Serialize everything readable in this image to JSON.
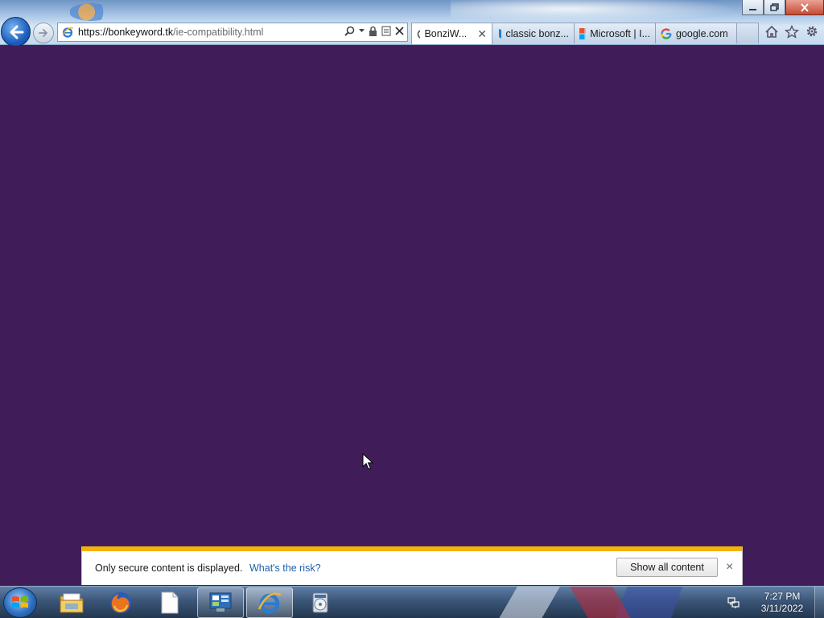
{
  "browser": {
    "url_host": "https://bonkeyword.tk",
    "url_path": "/ie-compatibility.html",
    "tabs": [
      {
        "label": "BonziW...",
        "icon": "loading-spinner-icon",
        "active": true
      },
      {
        "label": "classic bonz...",
        "icon": "bing-icon",
        "active": false
      },
      {
        "label": "Microsoft | I...",
        "icon": "microsoft-logo-icon",
        "active": false
      },
      {
        "label": "google.com",
        "icon": "google-icon",
        "active": false
      }
    ],
    "toolbar_icons": [
      "home-icon",
      "favorites-star-icon",
      "tools-gear-icon"
    ]
  },
  "page": {
    "background_color": "#401d59"
  },
  "notification": {
    "message": "Only secure content is displayed.",
    "link": "What's the risk?",
    "button": "Show all content",
    "close": "×",
    "accent_color": "#f3b30b"
  },
  "taskbar": {
    "apps": [
      "windows-explorer-icon",
      "firefox-icon",
      "blank-document-icon",
      "control-panel-icon",
      "internet-explorer-icon",
      "media-center-icon"
    ],
    "time": "7:27 PM",
    "date": "3/11/2022"
  }
}
